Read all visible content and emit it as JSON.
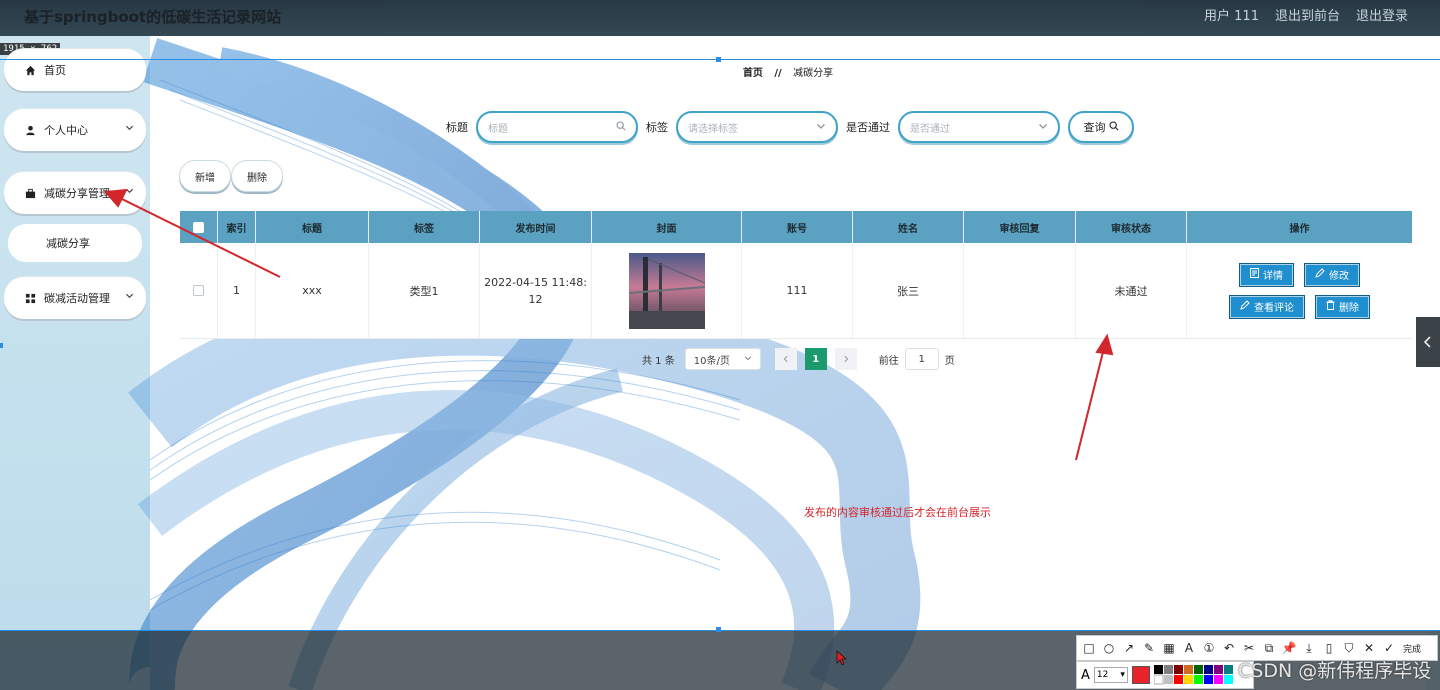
{
  "header": {
    "site_title": "基于springboot的低碳生活记录网站",
    "links": [
      "用户 111",
      "退出到前台",
      "退出登录"
    ]
  },
  "size_badge": "1915 × 762",
  "sidebar": {
    "items": [
      {
        "label": "首页",
        "icon": "home-icon"
      },
      {
        "label": "个人中心",
        "icon": "user-icon"
      },
      {
        "label": "减碳分享管理",
        "icon": "folder-icon"
      },
      {
        "label": "减碳分享",
        "icon": ""
      },
      {
        "label": "碳减活动管理",
        "icon": "grid-icon"
      }
    ]
  },
  "breadcrumb": {
    "home": "首页",
    "separator": "//",
    "current": "减碳分享"
  },
  "search": {
    "title_label": "标题",
    "title_placeholder": "标题",
    "tag_label": "标签",
    "tag_placeholder": "请选择标签",
    "passed_label": "是否通过",
    "passed_placeholder": "是否通过",
    "query_label": "查询"
  },
  "actions": {
    "add_label": "新增",
    "delete_label": "删除"
  },
  "table": {
    "columns": [
      "索引",
      "标题",
      "标签",
      "发布时间",
      "封面",
      "账号",
      "姓名",
      "审核回复",
      "审核状态",
      "操作"
    ],
    "rows": [
      {
        "index": "1",
        "title": "xxx",
        "tag": "类型1",
        "published_time_line1": "2022-04-15 11:48:",
        "published_time_line2": "12",
        "account": "111",
        "name": "张三",
        "review_reply": "",
        "review_status": "未通过",
        "ops": {
          "detail": "详情",
          "edit": "修改",
          "comments": "查看评论",
          "delete": "删除"
        }
      }
    ]
  },
  "pagination": {
    "total": "共 1 条",
    "page_size": "10条/页",
    "current_page": "1",
    "goto_label": "前往",
    "goto_value": "1",
    "page_suffix": "页"
  },
  "annotation_note": "发布的内容审核通过后才会在前台展示",
  "snip_toolbar": {
    "done_label": "完成",
    "font_size": "12"
  },
  "watermark": "CSDN @新伟程序毕设",
  "colors": {
    "table_header": "#5aa1c2",
    "op_button": "#1f8fcf",
    "page_active": "#1b9a6d",
    "note_red": "#d3262a",
    "frame_blue": "#2a8de0"
  }
}
